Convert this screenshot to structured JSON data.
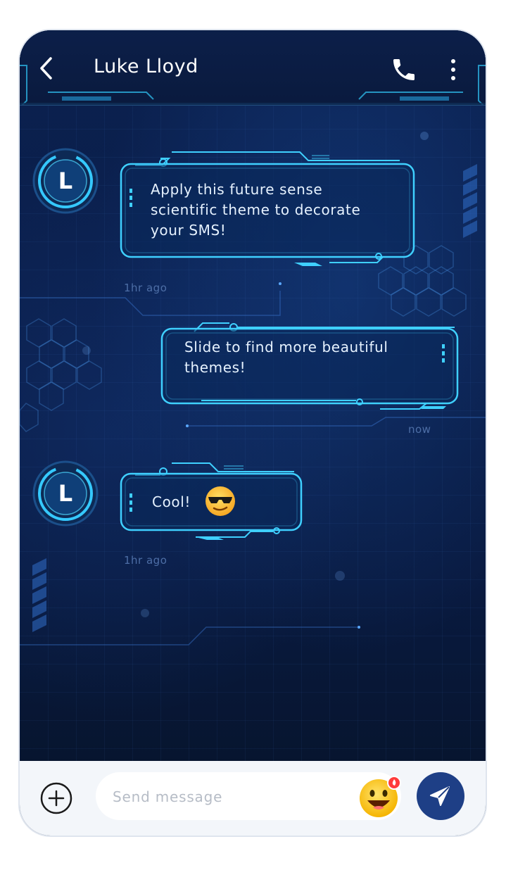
{
  "header": {
    "contact_name": "Luke Lloyd"
  },
  "messages": [
    {
      "direction": "incoming",
      "avatar_letter": "L",
      "text": "Apply this future sense scientific theme to decorate your SMS!",
      "lines": [
        "Apply this future sense",
        "scientific theme to decorate",
        "your SMS!"
      ],
      "time": "1hr ago"
    },
    {
      "direction": "outgoing",
      "text": "Slide to find more beautiful themes!",
      "lines": [
        "Slide to find more beautiful",
        "themes!"
      ],
      "time": "now"
    },
    {
      "direction": "incoming",
      "avatar_letter": "L",
      "text": "Cool!",
      "emoji": "sunglasses-face",
      "time": "1hr ago"
    }
  ],
  "input": {
    "placeholder": "Send message"
  },
  "icons": {
    "back": "chevron-left-icon",
    "call": "phone-icon",
    "menu": "more-vertical-icon",
    "add": "plus-circle-icon",
    "emoji": "emoji-face-icon",
    "send": "send-icon"
  },
  "colors": {
    "background": "#0a1d48",
    "neon": "#3fd0ff",
    "text": "#e6f2ff",
    "timestamp": "#4d6ea6",
    "send_button": "#1e3f86",
    "input_bar": "#f3f6fa"
  }
}
